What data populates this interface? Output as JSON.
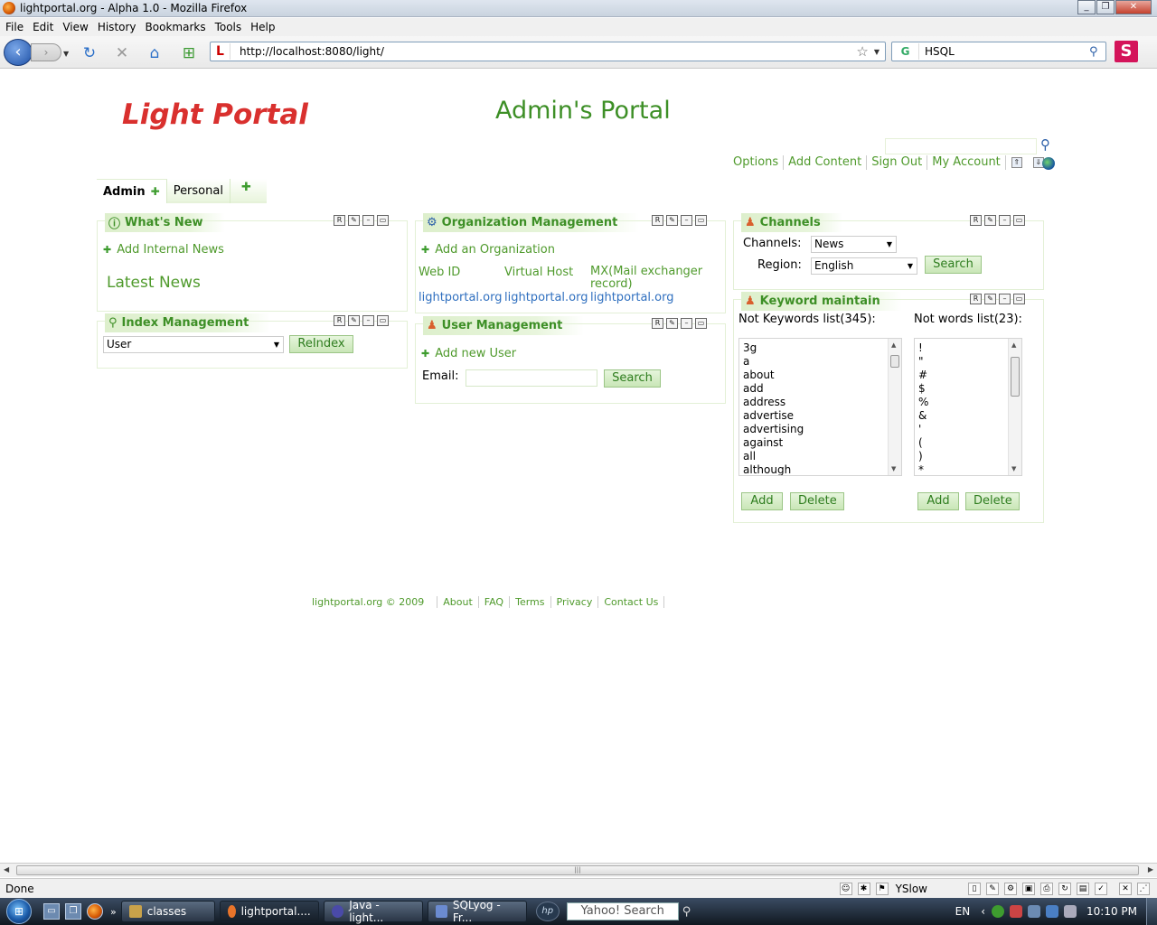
{
  "window": {
    "title": "lightportal.org - Alpha 1.0 - Mozilla Firefox"
  },
  "menu": [
    "File",
    "Edit",
    "View",
    "History",
    "Bookmarks",
    "Tools",
    "Help"
  ],
  "toolbar": {
    "url": "http://localhost:8080/light/",
    "site_icon": "L",
    "search_engine": "G",
    "search_value": "HSQL",
    "s_button": "S"
  },
  "page": {
    "logo": "Light Portal",
    "title": "Admin's Portal",
    "top_links": [
      "Options",
      "Add Content",
      "Sign Out",
      "My Account"
    ],
    "tabs": [
      {
        "label": "Admin",
        "active": true
      },
      {
        "label": "Personal",
        "active": false
      }
    ]
  },
  "whats_new": {
    "title": "What's New",
    "add_link": "Add Internal News",
    "latest": "Latest News"
  },
  "index_mgmt": {
    "title": "Index Management",
    "select_value": "User",
    "button": "ReIndex"
  },
  "org_mgmt": {
    "title": "Organization Management",
    "add_link": "Add an Organization",
    "col1": "Web ID",
    "col2": "Virtual Host",
    "col3": "MX(Mail exchanger record)",
    "row": [
      "lightportal.org",
      "lightportal.org",
      "lightportal.org"
    ]
  },
  "user_mgmt": {
    "title": "User Management",
    "add_link": "Add new User",
    "email_label": "Email:",
    "button": "Search"
  },
  "channels": {
    "title": "Channels",
    "channels_label": "Channels:",
    "channels_value": "News",
    "region_label": "Region:",
    "region_value": "English",
    "button": "Search"
  },
  "keyword": {
    "title": "Keyword maintain",
    "list1_label": "Not Keywords list(345):",
    "list2_label": "Not words list(23):",
    "list1": [
      "3g",
      "a",
      "about",
      "add",
      "address",
      "advertise",
      "advertising",
      "against",
      "all",
      "although"
    ],
    "list2": [
      "!",
      "\"",
      "#",
      "$",
      "%",
      "&",
      "'",
      "(",
      ")",
      "*"
    ],
    "add": "Add",
    "delete": "Delete"
  },
  "footer": [
    "lightportal.org © 2009",
    "About",
    "FAQ",
    "Terms",
    "Privacy",
    "Contact Us"
  ],
  "status": {
    "text": "Done",
    "yslow": "YSlow"
  },
  "taskbar": {
    "items": [
      "classes",
      "lightportal....",
      "Java - light...",
      "SQLyog - Fr..."
    ],
    "yahoo": "Yahoo! Search",
    "lang": "EN",
    "clock": "10:10 PM"
  }
}
